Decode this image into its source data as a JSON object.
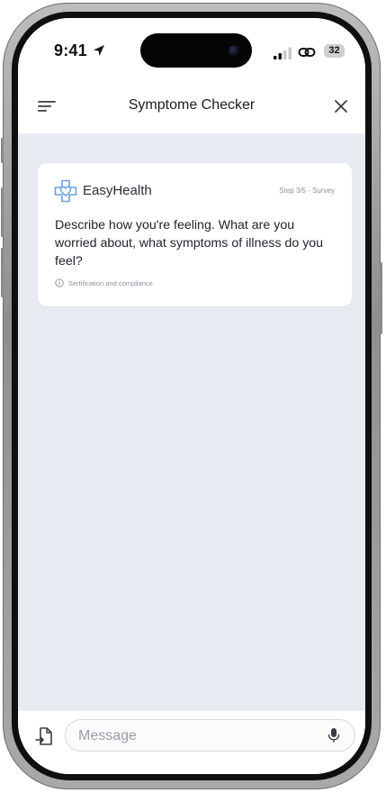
{
  "status_bar": {
    "time": "9:41",
    "battery": "32",
    "icons": [
      "location-arrow-icon",
      "cellular-signal-icon",
      "link-icon",
      "battery-icon"
    ]
  },
  "nav": {
    "title": "Symptome Checker",
    "left_icon": "menu-icon",
    "right_icon": "close-icon"
  },
  "card": {
    "brand": "EasyHealth",
    "step": "Step 3/5 · Survey",
    "question": "Describe how you're feeling. What are you worried about, what symptoms of illness do you feel?",
    "footnote": "Sertification and compliance",
    "logo_icon": "health-shield-icon"
  },
  "composer": {
    "placeholder": "Message",
    "value": "",
    "left_icon": "attachment-icon",
    "right_icon": "microphone-icon"
  },
  "colors": {
    "background": "#e7ebf1",
    "card": "#ffffff",
    "brand_blue": "#6a9ee0",
    "text_primary": "#1e2128",
    "text_secondary": "#8a8f99"
  }
}
